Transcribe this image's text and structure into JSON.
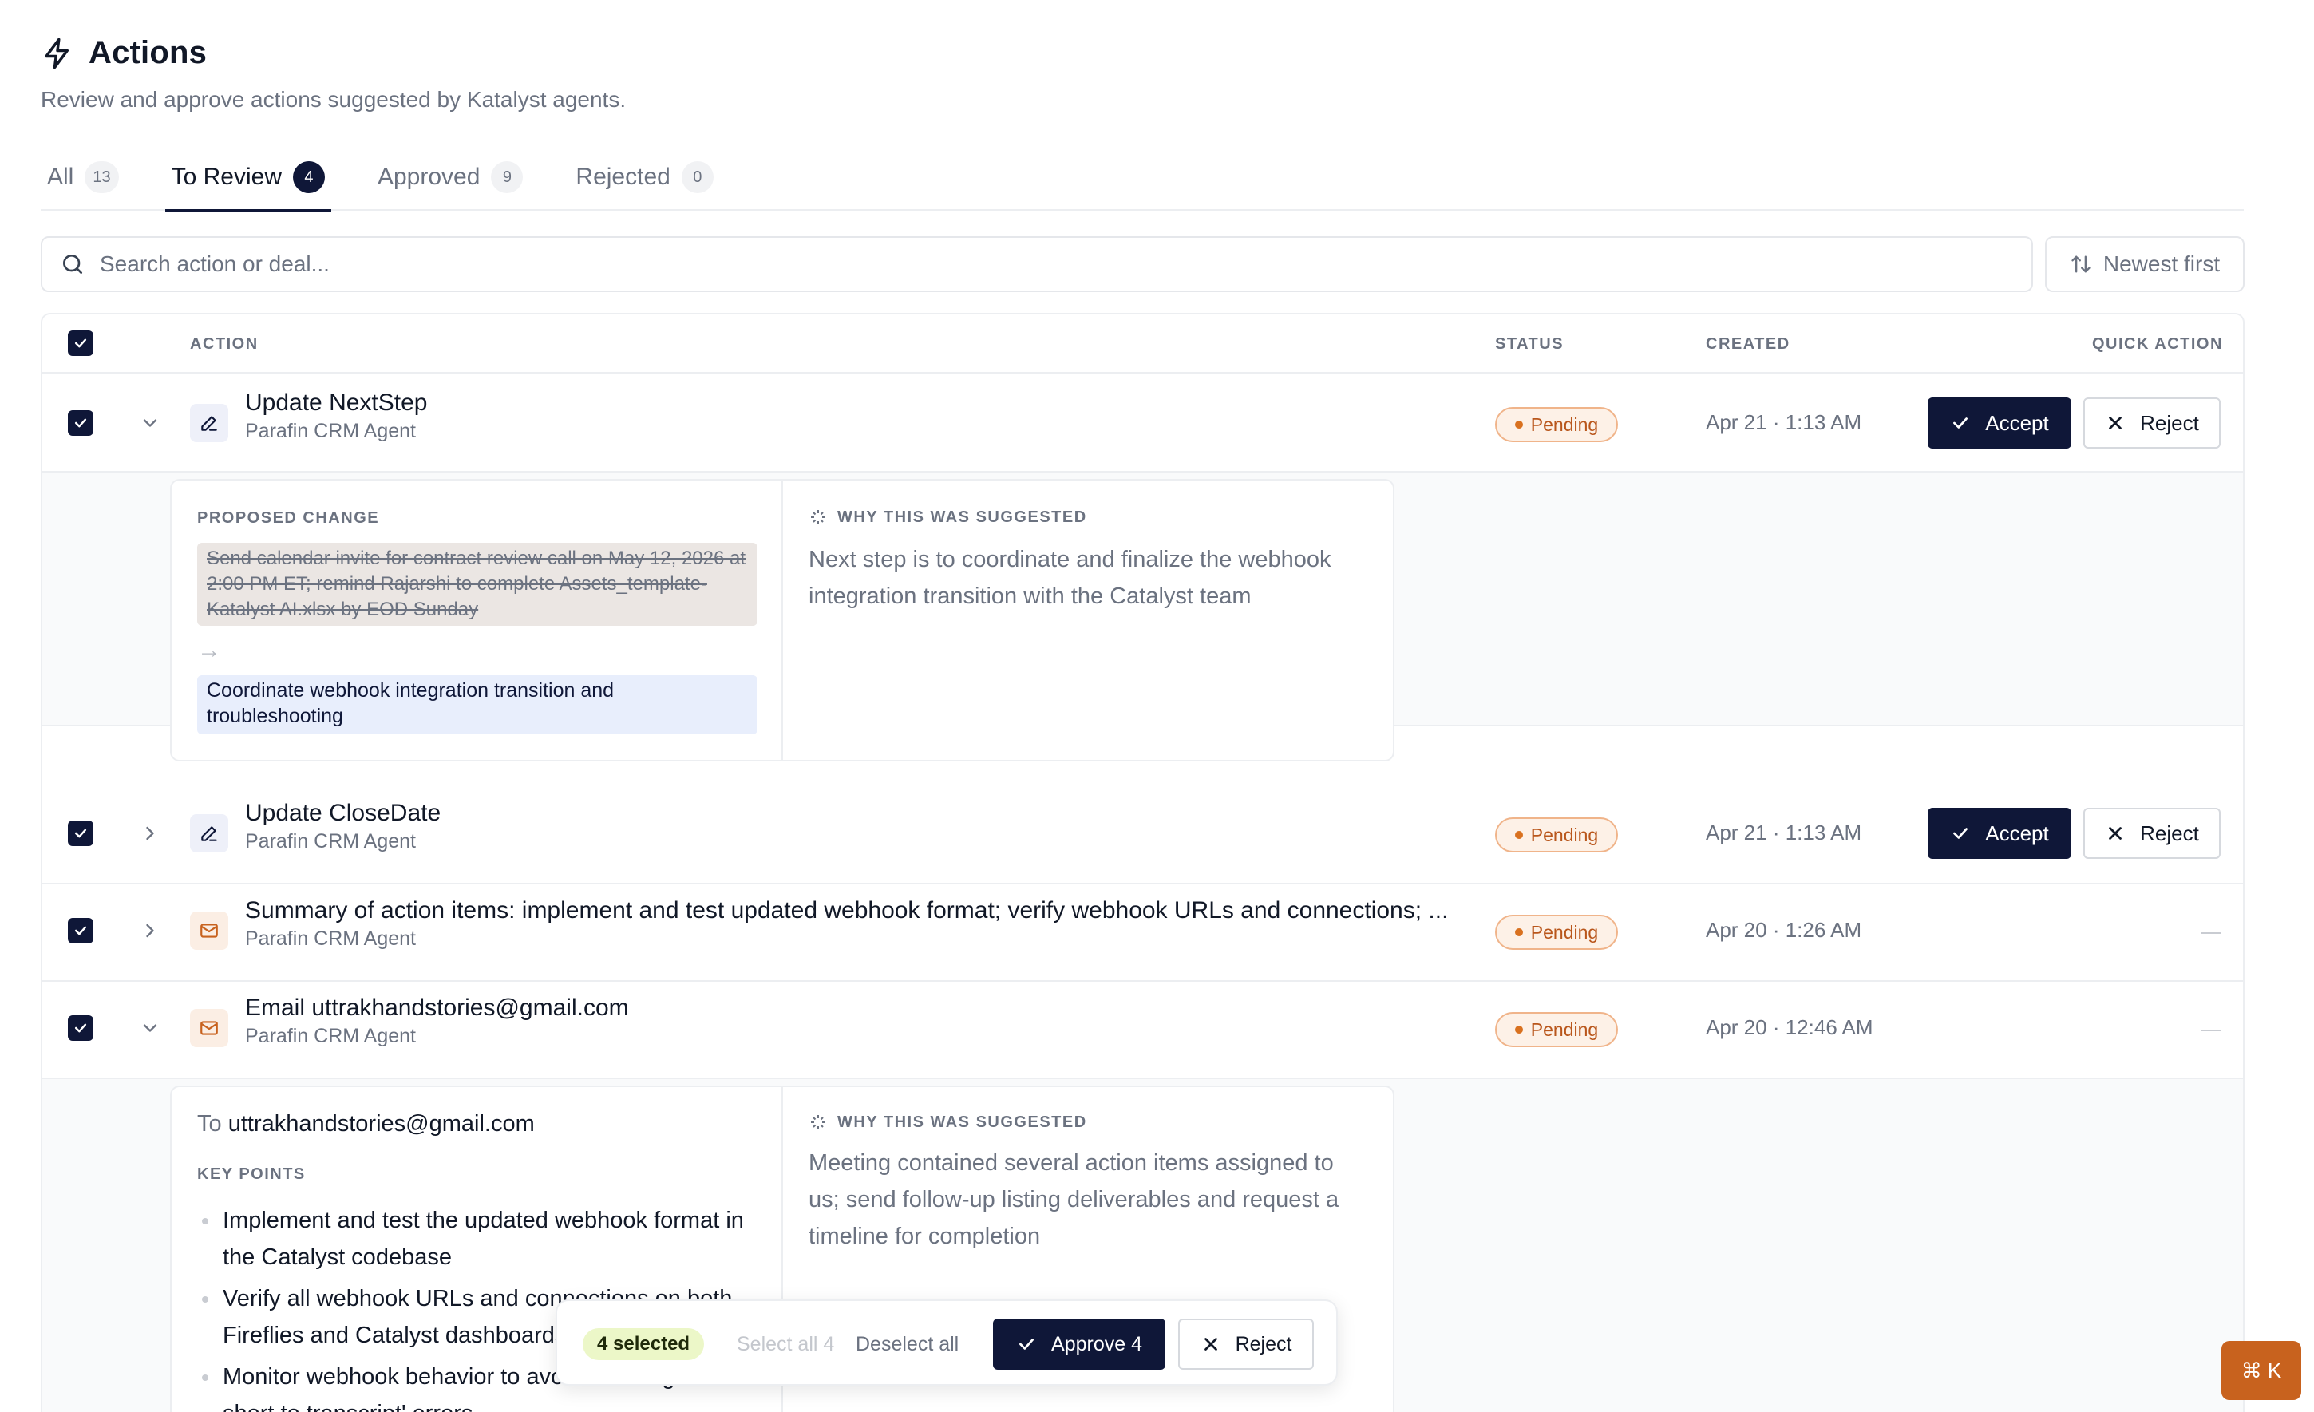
{
  "header": {
    "title": "Actions",
    "subtitle": "Review and approve actions suggested by Katalyst agents."
  },
  "tabs": [
    {
      "label": "All",
      "count": "13"
    },
    {
      "label": "To Review",
      "count": "4"
    },
    {
      "label": "Approved",
      "count": "9"
    },
    {
      "label": "Rejected",
      "count": "0"
    }
  ],
  "search": {
    "placeholder": "Search action or deal..."
  },
  "sort": {
    "label": "Newest first"
  },
  "table": {
    "headers": {
      "action": "ACTION",
      "status": "STATUS",
      "created": "CREATED",
      "quick_action": "QUICK ACTION"
    },
    "rows": [
      {
        "title": "Update NextStep",
        "agent": "Parafin CRM Agent",
        "status": "Pending",
        "created": "Apr 21 · 1:13 AM",
        "icon": "edit-icon"
      },
      {
        "title": "Update CloseDate",
        "agent": "Parafin CRM Agent",
        "status": "Pending",
        "created": "Apr 21 · 1:13 AM",
        "icon": "edit-icon"
      },
      {
        "title": "Summary of action items: implement and test updated webhook format; verify webhook URLs and connections; ...",
        "agent": "Parafin CRM Agent",
        "status": "Pending",
        "created": "Apr 20 · 1:26 AM",
        "icon": "mail-icon"
      },
      {
        "title": "Email uttrakhandstories@gmail.com",
        "agent": "Parafin CRM Agent",
        "status": "Pending",
        "created": "Apr 20 · 12:46 AM",
        "icon": "mail-icon"
      }
    ],
    "accept_label": "Accept",
    "reject_label": "Reject"
  },
  "detail_nextstep": {
    "proposed_label": "PROPOSED CHANGE",
    "old_value": "Send calendar invite for contract review call on May 12, 2026 at 2:00 PM ET; remind Rajarshi to complete Assets_template-Katalyst AI.xlsx by EOD Sunday",
    "arrow": "→",
    "new_value": "Coordinate webhook integration transition and troubleshooting",
    "why_label": "WHY THIS WAS SUGGESTED",
    "why_text": "Next step is to coordinate and finalize the webhook integration transition with the Catalyst team"
  },
  "detail_email": {
    "to_prefix": "To",
    "to_address": "uttrakhandstories@gmail.com",
    "key_points_label": "KEY POINTS",
    "key_points": [
      "Implement and test the updated webhook format in the Catalyst codebase",
      "Verify all webhook URLs and connections on both Fireflies and Catalyst dashboards",
      "Monitor webhook behavior to avoid 'Meeting too short to transcript' errors"
    ],
    "why_label": "WHY THIS WAS SUGGESTED",
    "why_text": "Meeting contained several action items assigned to us; send follow-up listing deliverables and request a timeline for completion"
  },
  "bulk_bar": {
    "selected": "4 selected",
    "select_all": "Select all 4",
    "deselect_all": "Deselect all",
    "approve": "Approve 4",
    "reject": "Reject"
  },
  "command": {
    "label": "⌘ K"
  },
  "colors": {
    "primary": "#0f1738",
    "pending_bg": "#fdf1e7",
    "pending_text": "#b9561b",
    "selected_pill": "#ecf7c8",
    "cmdk": "#c8621e"
  }
}
